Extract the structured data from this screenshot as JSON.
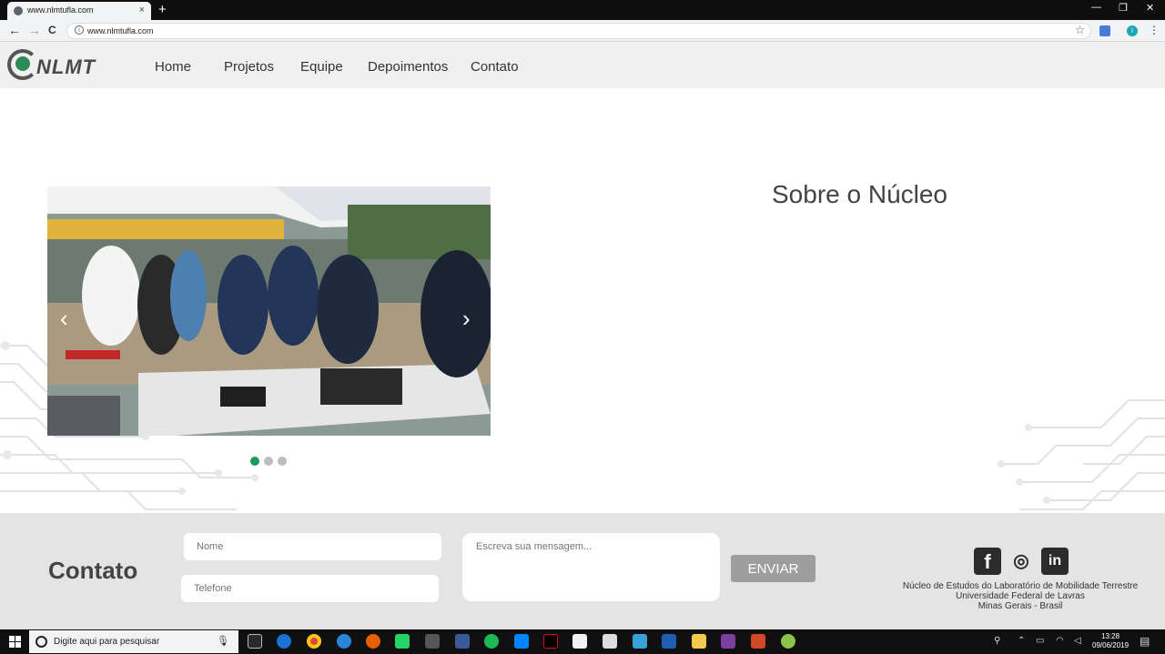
{
  "browser": {
    "tab_title": "www.nlmtufla.com",
    "tab_close": "×",
    "new_tab": "+",
    "url": "www.nlmtufla.com",
    "back": "←",
    "forward": "→",
    "reload": "C",
    "star": "☆",
    "info": "i",
    "profile_initial": "i",
    "menu": "⋮",
    "win_min": "—",
    "win_restore": "❐",
    "win_close": "✕"
  },
  "site": {
    "logo_text": "NLMT",
    "nav": [
      "Home",
      "Projetos",
      "Equipe",
      "Depoimentos",
      "Contato"
    ],
    "about_title": "Sobre o Núcleo",
    "carousel": {
      "prev": "‹",
      "next": "›",
      "active_index": 0,
      "slide_count": 3
    },
    "accent_color": "#1a9c5a"
  },
  "contact": {
    "title": "Contato",
    "name_placeholder": "Nome",
    "phone_placeholder": "Telefone",
    "message_placeholder": "Escreva sua mensagem...",
    "send_label": "ENVIAR",
    "social": [
      "facebook-icon",
      "instagram-icon",
      "linkedin-icon"
    ],
    "social_glyphs": [
      "f",
      "◎",
      "in"
    ],
    "address": [
      "Núcleo de Estudos do Laboratório de Mobilidade Terrestre",
      "Universidade Federal de Lavras",
      "Minas Gerais - Brasil"
    ]
  },
  "taskbar": {
    "search_placeholder": "Digite aqui para pesquisar",
    "time": "13:28",
    "date": "09/06/2019"
  }
}
